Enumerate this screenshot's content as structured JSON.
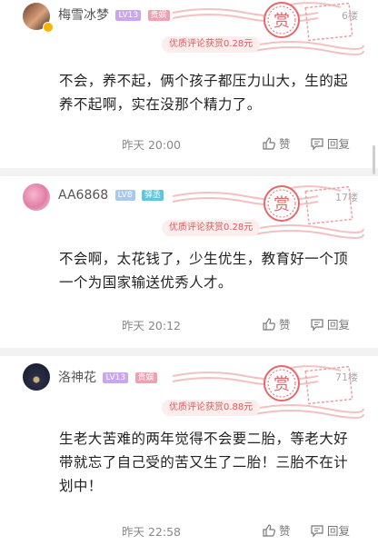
{
  "comments": [
    {
      "username": "梅雪冰梦",
      "level": "LV13",
      "role": "贵娱",
      "floor": "6楼",
      "stamp": "赏",
      "reward": "优质评论获赏0.28元",
      "text": "不会，养不起，俩个孩子都压力山大，生的起养不起啊，实在没那个精力了。",
      "time": "昨天 20:00",
      "like": "赞",
      "reply": "回复"
    },
    {
      "username": "AA6868",
      "level": "LV8",
      "role": "驿丞",
      "floor": "17楼",
      "stamp": "赏",
      "reward": "优质评论获赏0.28元",
      "text": "不会啊，太花钱了，少生优生，教育好一个顶一个为国家输送优秀人才。",
      "time": "昨天 20:12",
      "like": "赞",
      "reply": "回复"
    },
    {
      "username": "洛神花",
      "level": "LV13",
      "role": "贵娱",
      "floor": "71楼",
      "stamp": "赏",
      "reward": "优质评论获赏0.88元",
      "text": "生老大苦难的两年觉得不会要二胎，等老大好带就忘了自己受的苦又生了二胎！三胎不在计划中！",
      "time": "昨天 22:58",
      "like": "赞",
      "reply": "回复"
    }
  ],
  "colors": {
    "level_badge": "#c9a6f0",
    "role_badge_gold": "#f0a0b0",
    "role_badge_teal": "#5fc6d9",
    "stamp_red": "#e8666a"
  }
}
